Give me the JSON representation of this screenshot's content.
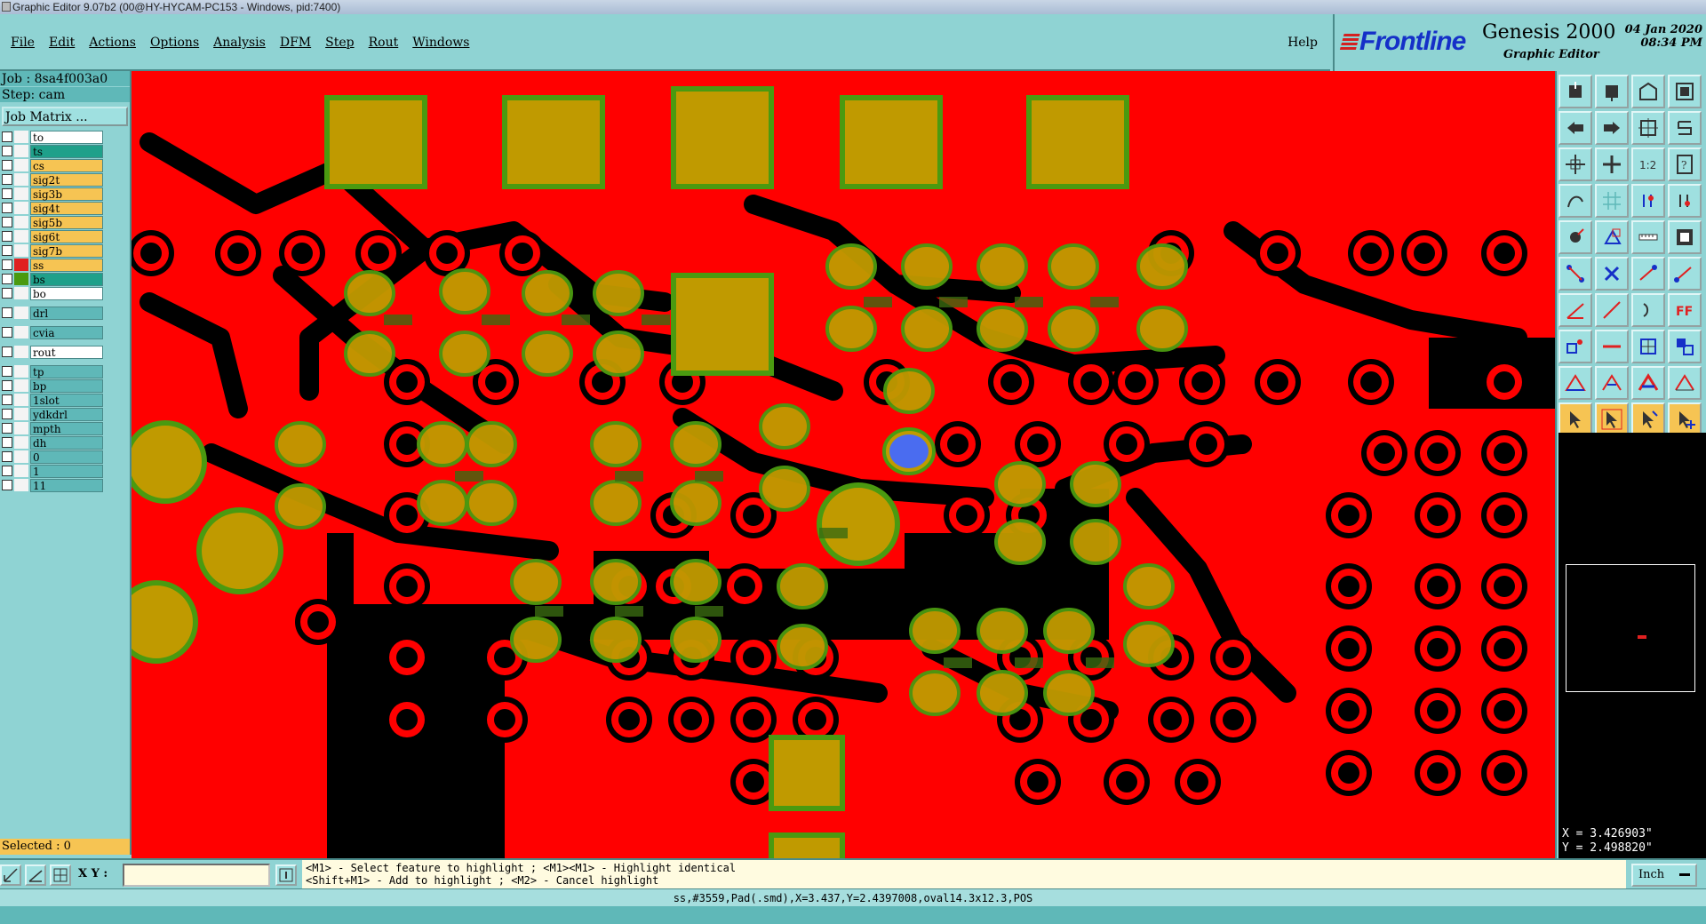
{
  "window": {
    "title": "Graphic Editor 9.07b2 (00@HY-HYCAM-PC153 - Windows, pid:7400)"
  },
  "menubar": {
    "items": [
      "File",
      "Edit",
      "Actions",
      "Options",
      "Analysis",
      "DFM",
      "Step",
      "Rout",
      "Windows"
    ],
    "help": "Help"
  },
  "brand": {
    "logo": "Frontline",
    "product": "Genesis 2000",
    "subtitle": "Graphic Editor",
    "date": "04 Jan 2020",
    "time": "08:34 PM"
  },
  "left": {
    "job": "Job : 8sa4f003a0",
    "step": "Step: cam",
    "job_matrix": "Job Matrix ...",
    "board_layers": [
      {
        "name": "to",
        "color": "#ffffff",
        "style": "white"
      },
      {
        "name": "ts",
        "color": "#1fa08a",
        "style": "sel"
      },
      {
        "name": "cs",
        "color": "#f6c453",
        "style": "board"
      },
      {
        "name": "sig2t",
        "color": "#f6c453",
        "style": "board"
      },
      {
        "name": "sig3b",
        "color": "#f6c453",
        "style": "board"
      },
      {
        "name": "sig4t",
        "color": "#f6c453",
        "style": "board"
      },
      {
        "name": "sig5b",
        "color": "#f6c453",
        "style": "board"
      },
      {
        "name": "sig6t",
        "color": "#f6c453",
        "style": "board"
      },
      {
        "name": "sig7b",
        "color": "#f6c453",
        "style": "board"
      },
      {
        "name": "ss",
        "color": "#f6c453",
        "style": "board"
      },
      {
        "name": "bs",
        "color": "#1fa08a",
        "style": "sel"
      },
      {
        "name": "bo",
        "color": "#ffffff",
        "style": "white"
      }
    ],
    "drill_layers": [
      "drl"
    ],
    "cvia_layers": [
      "cvia"
    ],
    "rout_layers": [
      "rout"
    ],
    "misc_layers": [
      "tp",
      "bp",
      "1slot",
      "ydkdrl",
      "mpth",
      "dh",
      "0",
      "1",
      "11"
    ],
    "selected": "Selected : 0"
  },
  "toolbar_icons": [
    "home-layer-icon",
    "save-down-icon",
    "building-icon",
    "window-icon",
    "arrow-left-icon",
    "arrow-right-icon",
    "fit-icon",
    "s-curve-icon",
    "move-icon",
    "zoom-icon",
    "ratio-icon",
    "question-icon",
    "hand-icon",
    "grid-icon",
    "snap-icon",
    "snap-alt-icon",
    "pad-icon",
    "outline-icon",
    "ruler-icon",
    "square-icon",
    "net-icon",
    "cross-icon",
    "line-icon",
    "line-alt-icon",
    "angle-icon",
    "slash-icon",
    "arc-icon",
    "text-icon",
    "pad-add-icon",
    "line-red-icon",
    "box-icon",
    "group-icon",
    "triangle-icon",
    "triangle-alt-icon",
    "triangle-bold-icon",
    "triangle-line-icon",
    "pointer-icon",
    "pointer-select-icon",
    "pointer-edit-icon",
    "pointer-move-icon"
  ],
  "coords": {
    "x": "X = 3.426903\"",
    "y": "Y = 2.498820\""
  },
  "bottom": {
    "xy_label": "X Y :",
    "xy_value": "",
    "hint1": "<M1> - Select feature to highlight ; <M1><M1> - Highlight identical",
    "hint2": "<Shift+M1> - Add to highlight ; <M2> - Cancel highlight",
    "units": "Inch",
    "status": "ss,#3559,Pad(.smd),X=3.437,Y=2.4397008,oval14.3x12.3,POS"
  },
  "colors": {
    "copper": "#ff0000",
    "pad": "#c09a00",
    "pad_edge": "#4a9a10",
    "highlight": "#4a6cf0"
  }
}
